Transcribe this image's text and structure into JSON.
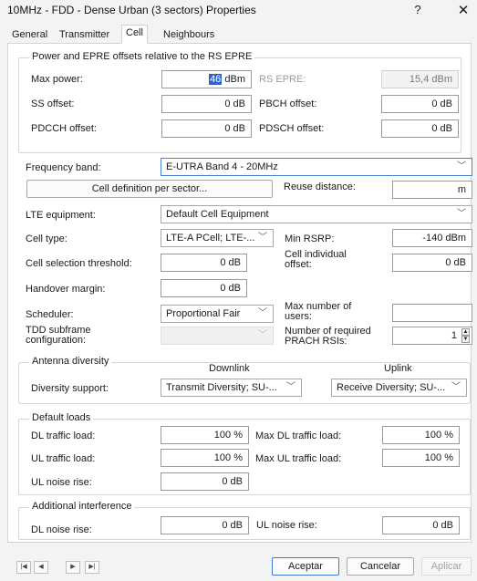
{
  "window": {
    "title": "10MHz - FDD - Dense Urban (3 sectors) Properties",
    "help": "?",
    "close": "✕"
  },
  "tabs": [
    "General",
    "Transmitter",
    "Cell",
    "Neighbours"
  ],
  "power_group": {
    "title": "Power and EPRE offsets relative to the RS EPRE",
    "max_power_label": "Max power:",
    "max_power_value": "46",
    "max_power_unit": "dBm",
    "rs_epre_label": "RS EPRE:",
    "rs_epre_value": "15,4 dBm",
    "ss_offset_label": "SS offset:",
    "ss_offset_value": "0 dB",
    "pbch_offset_label": "PBCH offset:",
    "pbch_offset_value": "0 dB",
    "pdcch_offset_label": "PDCCH offset:",
    "pdcch_offset_value": "0 dB",
    "pdsch_offset_label": "PDSCH offset:",
    "pdsch_offset_value": "0 dB"
  },
  "frequency": {
    "label": "Frequency band:",
    "value": "E-UTRA Band 4 - 20MHz",
    "cell_def_button": "Cell definition per sector...",
    "reuse_label": "Reuse distance:",
    "reuse_value": "m"
  },
  "lte": {
    "equipment_label": "LTE equipment:",
    "equipment_value": "Default Cell Equipment",
    "cell_type_label": "Cell type:",
    "cell_type_value": "LTE-A PCell; LTE-...",
    "min_rsrp_label": "Min RSRP:",
    "min_rsrp_value": "-140 dBm",
    "cell_sel_label": "Cell selection threshold:",
    "cell_sel_value": "0 dB",
    "cell_ind_label": "Cell individual offset:",
    "cell_ind_value": "0 dB",
    "handover_label": "Handover margin:",
    "handover_value": "0 dB",
    "scheduler_label": "Scheduler:",
    "scheduler_value": "Proportional Fair",
    "max_users_label": "Max number of users:",
    "max_users_value": "",
    "tdd_label": "TDD subframe configuration:",
    "tdd_value": "",
    "prach_label": "Number of required PRACH RSIs:",
    "prach_value": "1"
  },
  "antenna": {
    "title": "Antenna diversity",
    "downlink_header": "Downlink",
    "uplink_header": "Uplink",
    "support_label": "Diversity support:",
    "downlink_value": "Transmit Diversity; SU-...",
    "uplink_value": "Receive Diversity; SU-..."
  },
  "loads": {
    "title": "Default loads",
    "dl_traffic_label": "DL traffic load:",
    "dl_traffic_value": "100 %",
    "max_dl_label": "Max DL traffic load:",
    "max_dl_value": "100 %",
    "ul_traffic_label": "UL traffic load:",
    "ul_traffic_value": "100 %",
    "max_ul_label": "Max UL traffic load:",
    "max_ul_value": "100 %",
    "ul_noise_label": "UL noise rise:",
    "ul_noise_value": "0 dB"
  },
  "interference": {
    "title": "Additional interference",
    "dl_noise_label": "DL noise rise:",
    "dl_noise_value": "0 dB",
    "ul_noise_label": "UL noise rise:",
    "ul_noise_value": "0 dB"
  },
  "footer": {
    "nav": [
      "|◀",
      "◀",
      "▶",
      "▶|"
    ],
    "ok": "Aceptar",
    "cancel": "Cancelar",
    "apply": "Aplicar"
  }
}
